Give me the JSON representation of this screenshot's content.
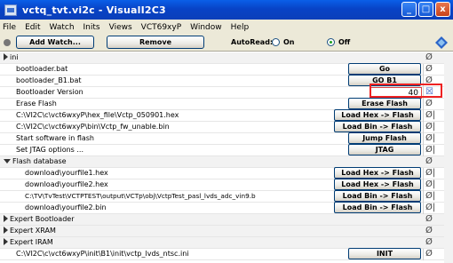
{
  "window": {
    "title": "vctq_tvt.vi2c - VisualI2C3",
    "controls": [
      "_",
      "□",
      "x"
    ]
  },
  "menu": [
    "File",
    "Edit",
    "Watch",
    "Inits",
    "Views",
    "VCT69xyP",
    "Window",
    "Help"
  ],
  "toolbar": {
    "add_watch": "Add Watch...",
    "remove": "Remove",
    "autoread_label": "AutoRead:",
    "on_label": "On",
    "off_label": "Off",
    "autoread_selected": "Off"
  },
  "symbols": {
    "none": "Ø",
    "checkbox": "☒"
  },
  "rows": [
    {
      "label": "ini",
      "type": "group-collapsed",
      "symbol": "Ø"
    },
    {
      "label": "bootloader.bat",
      "button": "Go",
      "symbol": "Ø"
    },
    {
      "label": "bootloader_B1.bat",
      "button": "GO B1",
      "symbol": "Ø"
    },
    {
      "label": "Bootloader Version",
      "value": "40",
      "symbol": "☒"
    },
    {
      "label": "Erase Flash",
      "button": "Erase Flash",
      "symbol": "Ø"
    },
    {
      "label": "C:\\VI2C\\c\\vct6wxyP\\hex_file\\Vctp_050901.hex",
      "button": "Load Hex -> Flash",
      "symbol": "Ø|"
    },
    {
      "label": "C:\\VI2C\\c\\vct6wxyP\\bin\\Vctp_fw_unable.bin",
      "button": "Load Bin -> Flash",
      "symbol": "Ø|"
    },
    {
      "label": "Start software in flash",
      "button": "Jump Flash",
      "symbol": "Ø|"
    },
    {
      "label": "Set JTAG options ...",
      "button": "JTAG",
      "symbol": "Ø|"
    },
    {
      "label": "Flash database",
      "type": "group-expanded",
      "symbol": "Ø"
    },
    {
      "label": "download\\yourfile1.hex",
      "button": "Load Hex -> Flash",
      "symbol": "Ø|"
    },
    {
      "label": "download\\yourfile2.hex",
      "button": "Load Hex -> Flash",
      "symbol": "Ø|"
    },
    {
      "label": "C:\\TV\\TvTest\\VCTPTEST\\output\\VCTp\\obj\\VctpTest_pasl_lvds_adc_vin9.b",
      "button": "Load Bin -> Flash",
      "symbol": "Ø|"
    },
    {
      "label": "download\\yourfile2.bin",
      "button": "Load Bin -> Flash",
      "symbol": "Ø|"
    },
    {
      "label": "Expert Bootloader",
      "type": "group-collapsed",
      "symbol": "Ø"
    },
    {
      "label": "Expert XRAM",
      "type": "group-collapsed",
      "symbol": "Ø"
    },
    {
      "label": "Expert IRAM",
      "type": "group-collapsed",
      "symbol": "Ø"
    },
    {
      "label": "C:\\VI2C\\c\\vct6wxyP\\init\\B1\\init\\vctp_lvds_ntsc.ini",
      "button": "INIT",
      "symbol": "Ø"
    }
  ]
}
